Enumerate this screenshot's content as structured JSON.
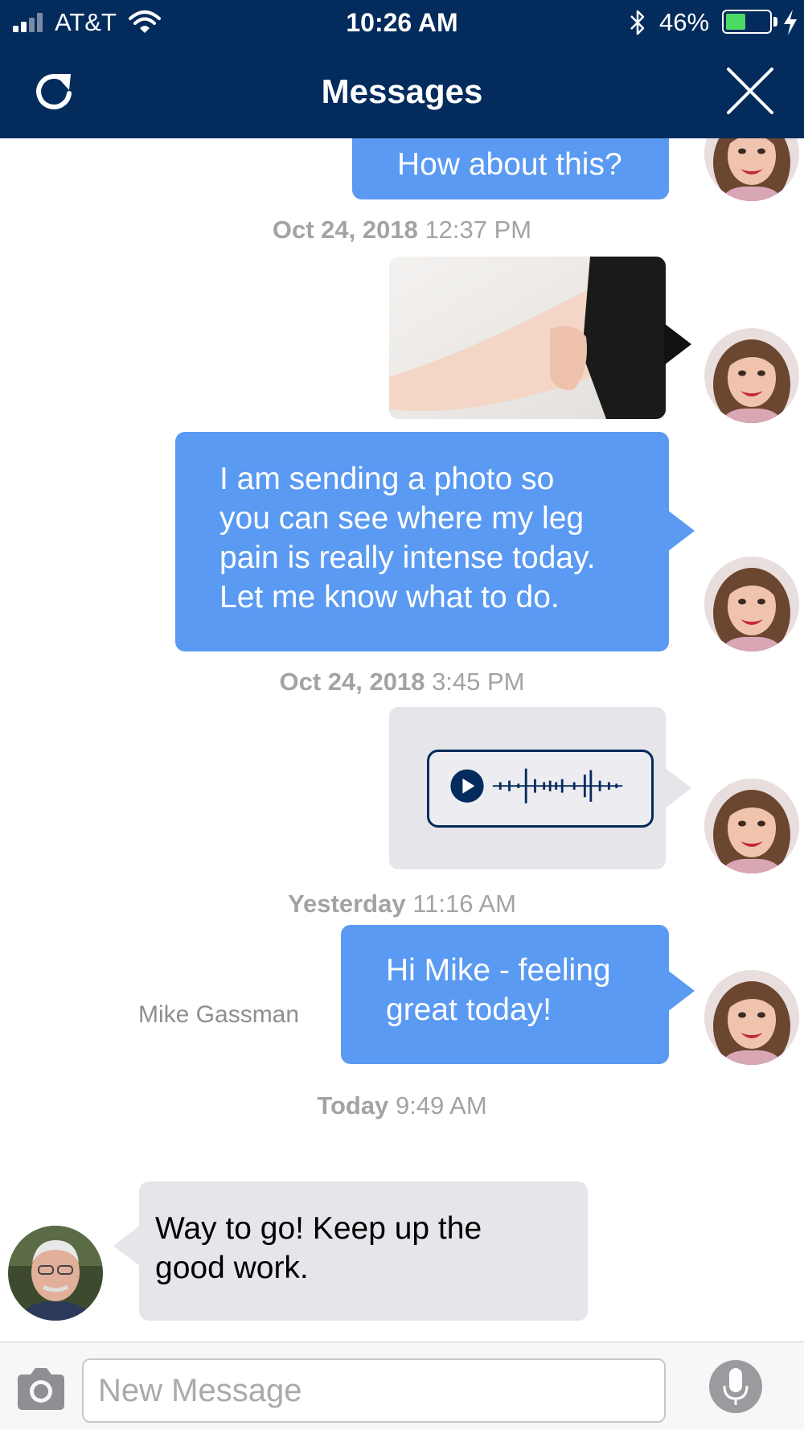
{
  "status_bar": {
    "carrier": "AT&T",
    "time": "10:26 AM",
    "battery": "46%",
    "battery_level": 0.46
  },
  "header": {
    "title": "Messages"
  },
  "messages": [
    {
      "text": "How about this?"
    },
    {
      "date": "Oct 24, 2018",
      "time": "12:37 PM"
    },
    {
      "text_lines": [
        "I am sending a photo so",
        "you can see where my leg",
        "pain is really intense today.",
        "Let me know what to do."
      ]
    },
    {
      "date": "Oct 24, 2018",
      "time": "3:45 PM"
    },
    {
      "date": "Yesterday",
      "time": "11:16 AM"
    },
    {
      "text_lines": [
        "Hi Mike - feeling",
        "great today!"
      ]
    },
    {
      "date": "Today",
      "time": "9:49 AM"
    },
    {
      "sender": "Mike Gassman",
      "text_lines": [
        "Way to go!  Keep up the",
        "good work."
      ]
    }
  ],
  "composer": {
    "placeholder": "New Message"
  },
  "colors": {
    "header": "#032b5c",
    "outgoing_bubble": "#5a9af2",
    "incoming_bubble": "#e5e5ea",
    "timestamp": "#a3a3a3"
  }
}
